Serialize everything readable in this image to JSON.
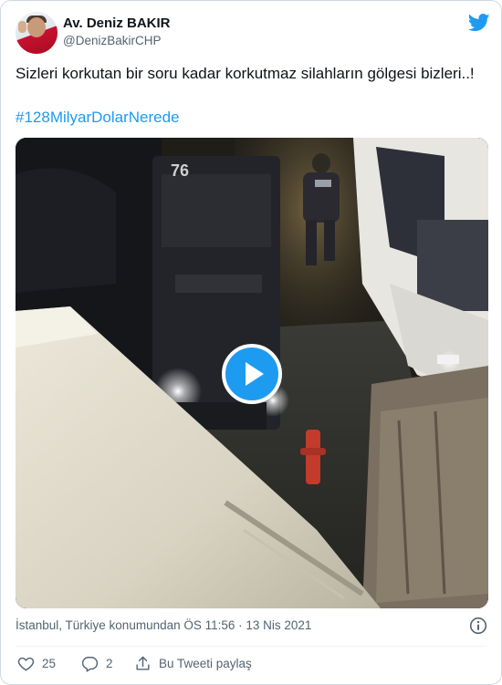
{
  "author": {
    "name": "Av. Deniz BAKIR",
    "handle": "@DenizBakirCHP"
  },
  "tweet": {
    "text": "Sizleri korkutan bir soru kadar korkutmaz silahların gölgesi bizleri..!",
    "hashtag": "#128MilyarDolarNerede",
    "meta": "İstanbul, Türkiye konumundan ÖS 11:56 · 13 Nis 2021"
  },
  "video_overlay_text": "76",
  "actions": {
    "like_count": "25",
    "reply_count": "2",
    "share_label": "Bu Tweeti paylaş"
  },
  "colors": {
    "accent": "#1d9bf0",
    "text": "#0f1419",
    "secondary": "#536471",
    "border": "#cfd9de",
    "like": "#f91880"
  },
  "icons": {
    "brand": "twitter-bird-icon",
    "play": "play-icon",
    "info": "info-icon",
    "like": "heart-icon",
    "reply": "reply-icon",
    "share": "share-icon"
  }
}
